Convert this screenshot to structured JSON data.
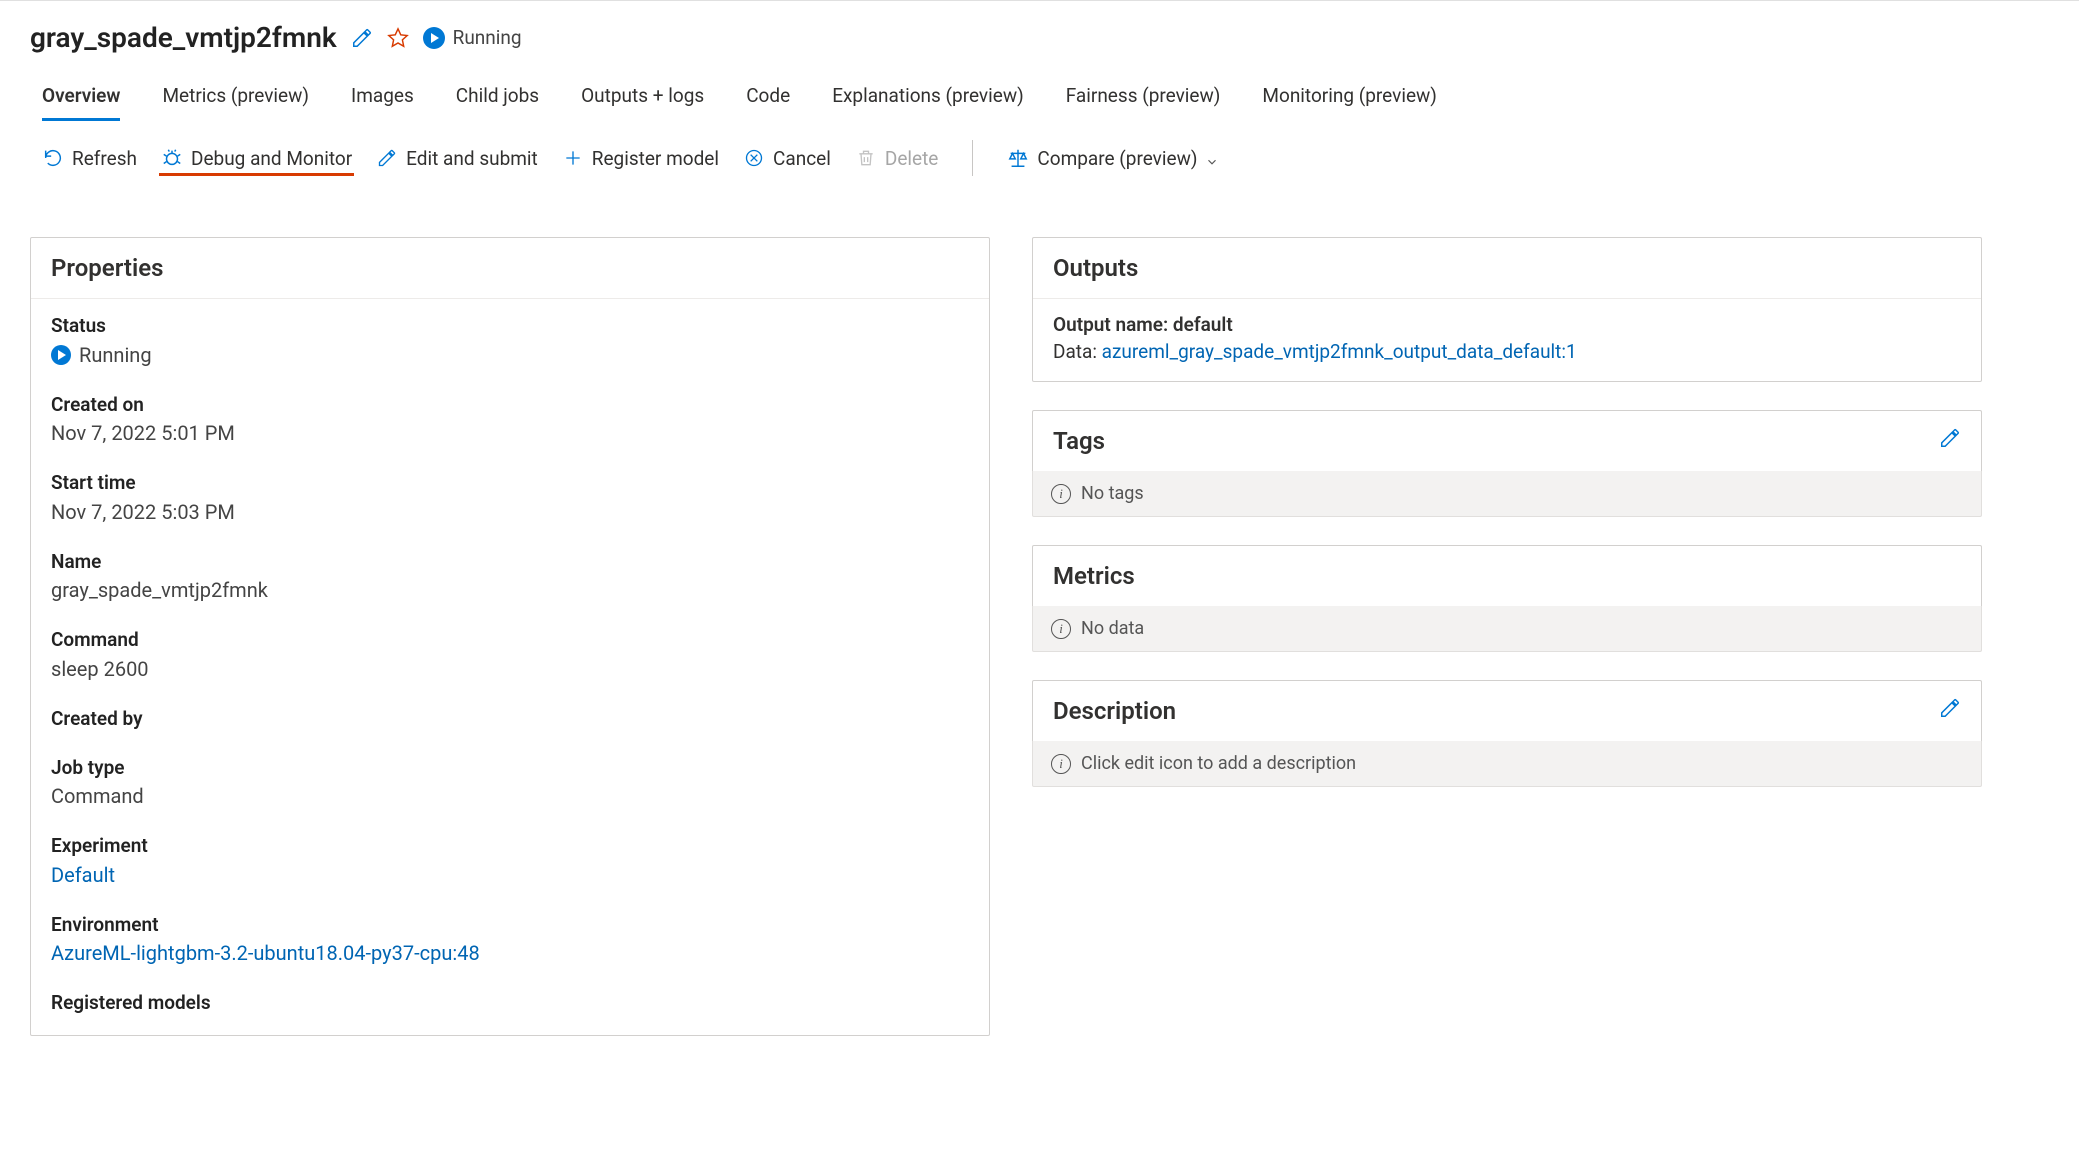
{
  "job": {
    "title": "gray_spade_vmtjp2fmnk",
    "status_label": "Running"
  },
  "tabs": [
    {
      "label": "Overview",
      "active": true
    },
    {
      "label": "Metrics (preview)"
    },
    {
      "label": "Images"
    },
    {
      "label": "Child jobs"
    },
    {
      "label": "Outputs + logs"
    },
    {
      "label": "Code"
    },
    {
      "label": "Explanations (preview)"
    },
    {
      "label": "Fairness (preview)"
    },
    {
      "label": "Monitoring (preview)"
    }
  ],
  "toolbar": {
    "refresh": "Refresh",
    "debug_monitor": "Debug and Monitor",
    "edit_submit": "Edit and submit",
    "register_model": "Register model",
    "cancel": "Cancel",
    "delete": "Delete",
    "compare": "Compare (preview)"
  },
  "properties": {
    "heading": "Properties",
    "status_label": "Status",
    "status_value": "Running",
    "created_on_label": "Created on",
    "created_on_value": "Nov 7, 2022 5:01 PM",
    "start_time_label": "Start time",
    "start_time_value": "Nov 7, 2022 5:03 PM",
    "name_label": "Name",
    "name_value": "gray_spade_vmtjp2fmnk",
    "command_label": "Command",
    "command_value": "sleep 2600",
    "created_by_label": "Created by",
    "created_by_value": "",
    "job_type_label": "Job type",
    "job_type_value": "Command",
    "experiment_label": "Experiment",
    "experiment_value": "Default",
    "environment_label": "Environment",
    "environment_value": "AzureML-lightgbm-3.2-ubuntu18.04-py37-cpu:48",
    "registered_models_label": "Registered models"
  },
  "outputs": {
    "heading": "Outputs",
    "name_label": "Output name: default",
    "data_prefix": "Data: ",
    "data_link": "azureml_gray_spade_vmtjp2fmnk_output_data_default:1"
  },
  "tags": {
    "heading": "Tags",
    "empty": "No tags"
  },
  "metrics": {
    "heading": "Metrics",
    "empty": "No data"
  },
  "description": {
    "heading": "Description",
    "empty": "Click edit icon to add a description"
  }
}
